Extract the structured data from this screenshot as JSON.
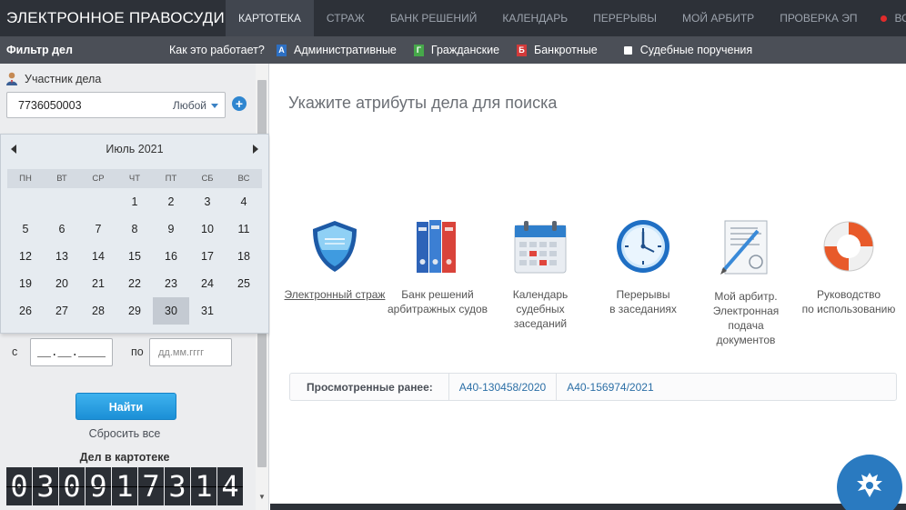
{
  "topbar": {
    "brand": "ЭЛЕКТРОННОЕ ПРАВОСУДИЕ",
    "nav": [
      "КАРТОТЕКА",
      "СТРАЖ",
      "БАНК РЕШЕНИЙ",
      "КАЛЕНДАРЬ",
      "ПЕРЕРЫВЫ",
      "МОЙ АРБИТР",
      "ПРОВЕРКА ЭП"
    ],
    "active_nav": "КАРТОТЕКА",
    "login": "ВОЙТИ"
  },
  "filterbar": {
    "title": "Фильтр дел",
    "howto": "Как это работает?",
    "types": [
      {
        "icon": "А",
        "label": "Административные"
      },
      {
        "icon": "Г",
        "label": "Гражданские"
      },
      {
        "icon": "Б",
        "label": "Банкротные"
      }
    ],
    "court_orders": "Судебные поручения"
  },
  "sidebar": {
    "participant_label": "Участник дела",
    "participant_value": "7736050003",
    "participant_role": "Любой",
    "add_symbol": "+",
    "date_from_label": "с",
    "date_from_value": "__.__.____",
    "date_to_label": "по",
    "date_to_placeholder": "дд.мм.гггг",
    "find_button": "Найти",
    "reset_link": "Сбросить все",
    "cases_label": "Дел в картотеке",
    "counter_digits": [
      "0",
      "3",
      "0",
      "9",
      "1",
      "7",
      "3",
      "1",
      "4"
    ]
  },
  "calendar": {
    "month_label": "Июль 2021",
    "weekdays": [
      "ПН",
      "ВТ",
      "СР",
      "ЧТ",
      "ПТ",
      "СБ",
      "ВС"
    ],
    "weeks": [
      [
        "",
        "",
        "",
        "1",
        "2",
        "3",
        "4"
      ],
      [
        "5",
        "6",
        "7",
        "8",
        "9",
        "10",
        "11"
      ],
      [
        "12",
        "13",
        "14",
        "15",
        "16",
        "17",
        "18"
      ],
      [
        "19",
        "20",
        "21",
        "22",
        "23",
        "24",
        "25"
      ],
      [
        "26",
        "27",
        "28",
        "29",
        "30",
        "31",
        ""
      ]
    ],
    "selected_day": "30"
  },
  "main": {
    "title": "Укажите атрибуты дела для поиска",
    "tiles": [
      {
        "icon": "shield-icon",
        "lines": [
          "Электронный страж"
        ]
      },
      {
        "icon": "binders-icon",
        "lines": [
          "Банк решений",
          "арбитражных судов"
        ]
      },
      {
        "icon": "calendar-icon",
        "lines": [
          "Календарь",
          "судебных",
          "заседаний"
        ]
      },
      {
        "icon": "clock-icon",
        "lines": [
          "Перерывы",
          "в заседаниях"
        ]
      },
      {
        "icon": "document-pen-icon",
        "lines": [
          "Мой арбитр.",
          "Электронная",
          "подача",
          "документов"
        ]
      },
      {
        "icon": "lifebuoy-icon",
        "lines": [
          "Руководство",
          "по использованию"
        ]
      }
    ],
    "viewed_label": "Просмотренные ранее:",
    "viewed_cases": [
      "А40-130458/2020",
      "А40-156974/2021"
    ]
  },
  "colors": {
    "topbar": "#2d3138",
    "filterbar": "#4b4f57",
    "accent": "#1b8fd6",
    "link": "#2c6fa6"
  }
}
